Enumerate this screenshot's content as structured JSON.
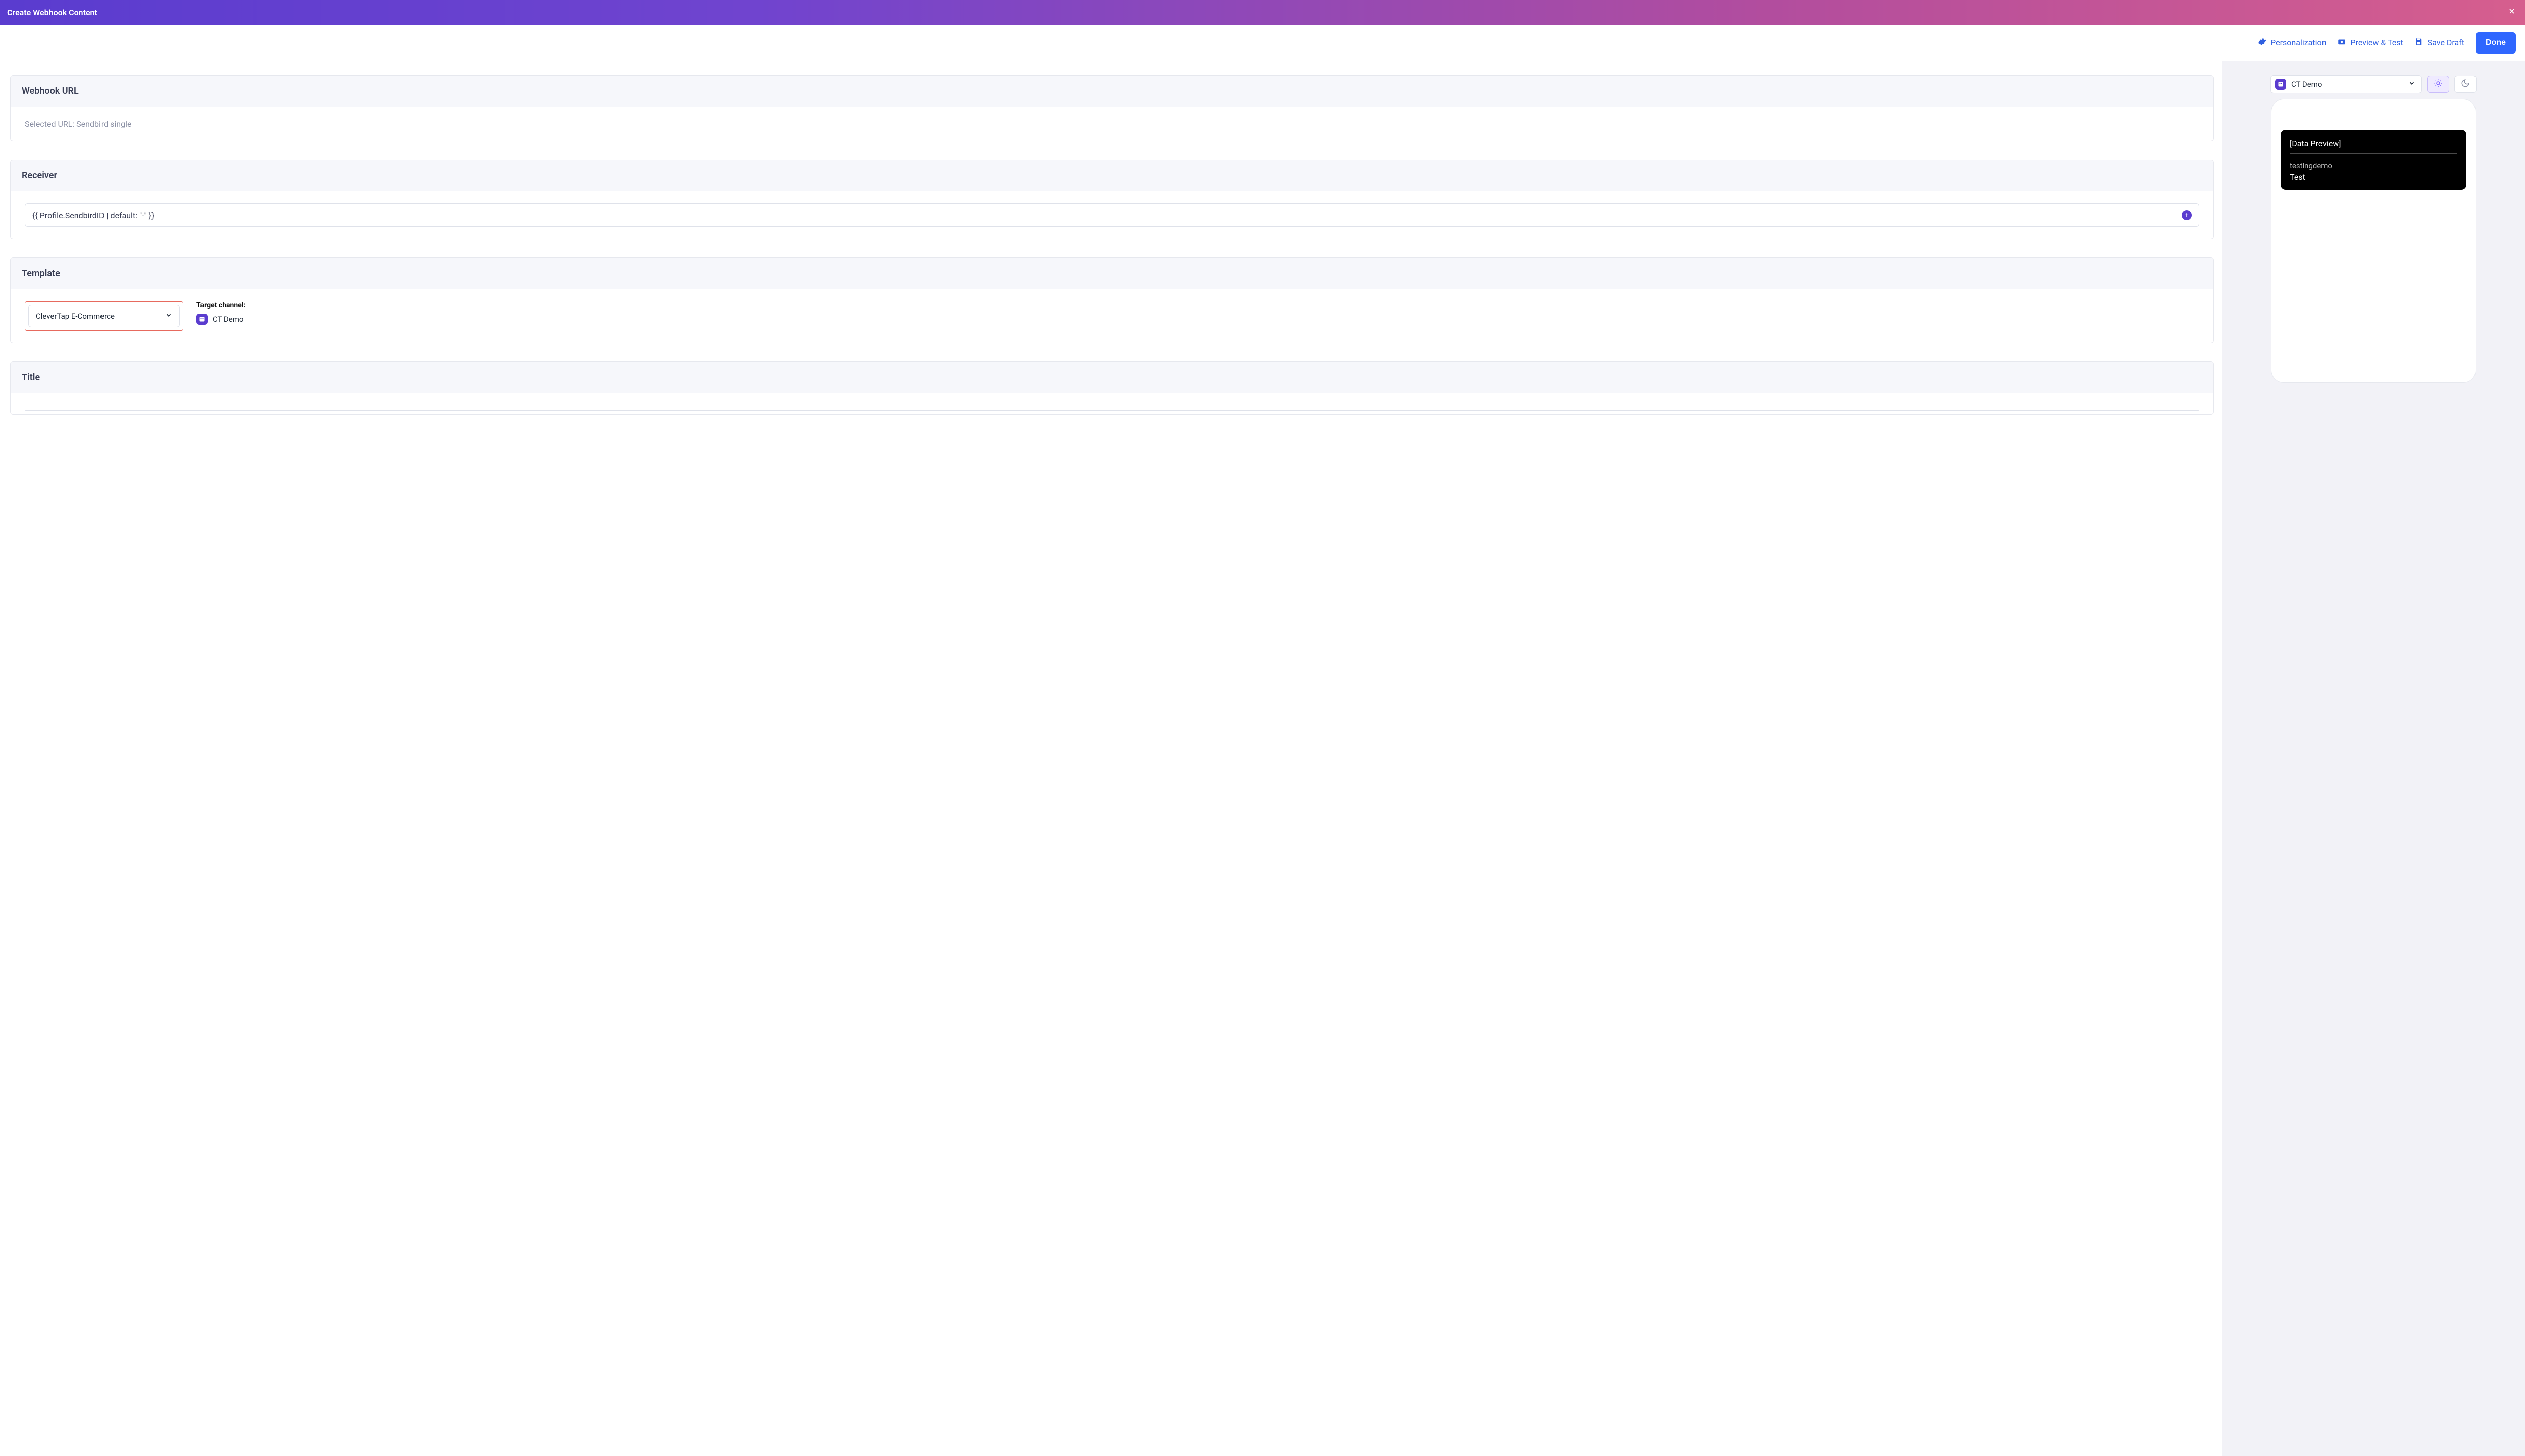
{
  "header": {
    "title": "Create Webhook Content"
  },
  "actions": {
    "personalization": "Personalization",
    "preview_test": "Preview & Test",
    "save_draft": "Save Draft",
    "done": "Done"
  },
  "sections": {
    "webhook_url": {
      "title": "Webhook URL",
      "selected_line": "Selected URL: Sendbird single"
    },
    "receiver": {
      "title": "Receiver",
      "value": "{{ Profile.SendbirdID | default: \"-\" }}"
    },
    "template": {
      "title": "Template",
      "selected": "CleverTap E-Commerce",
      "target_label": "Target channel:",
      "target_value": "CT Demo"
    },
    "title_section": {
      "title": "Title"
    }
  },
  "preview": {
    "selector_value": "CT Demo",
    "card_title": "[Data Preview]",
    "line1": "testingdemo",
    "line2": "Test"
  }
}
